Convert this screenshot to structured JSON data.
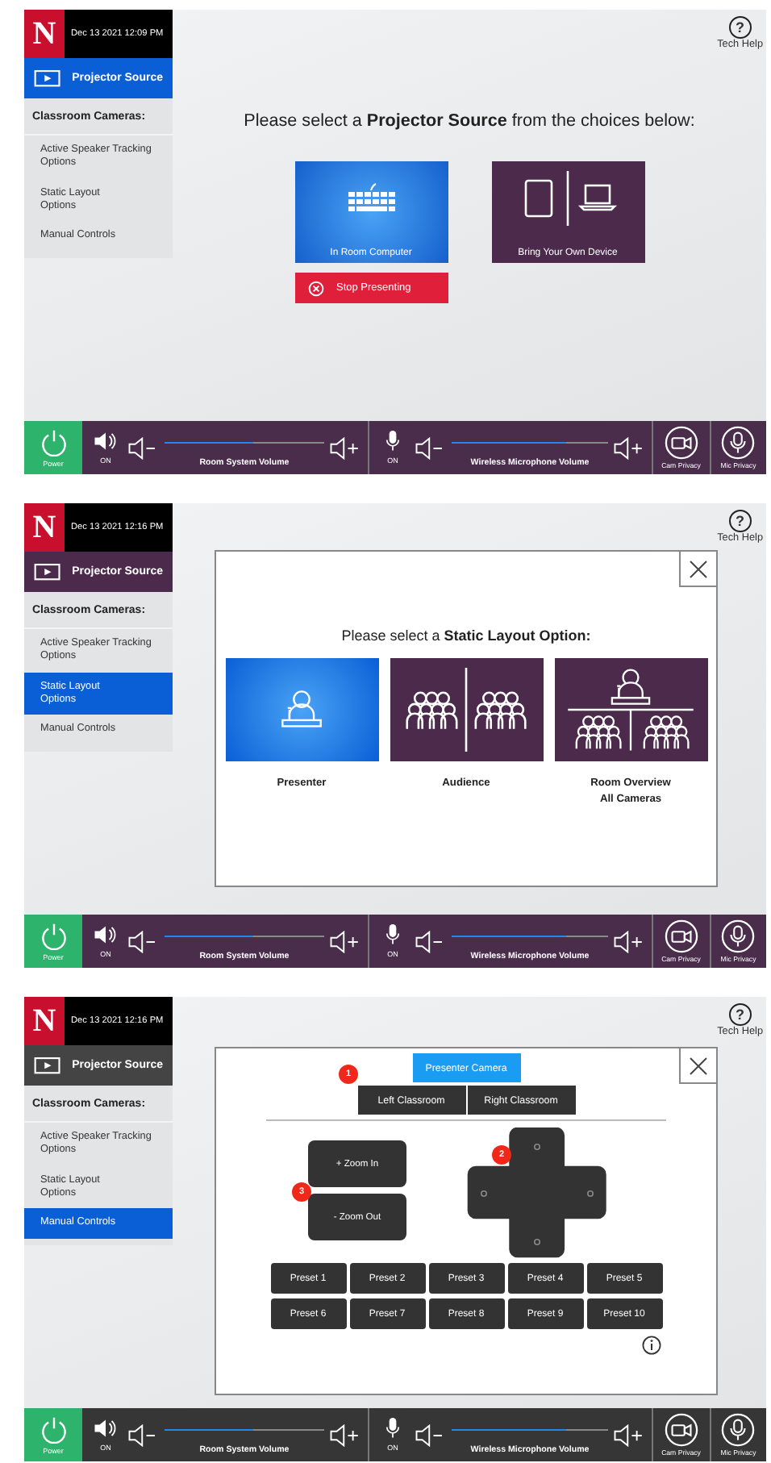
{
  "screens": [
    {
      "header": {
        "logo": "N",
        "date": "Dec 13 2021 12:09 PM"
      },
      "projector_source": {
        "label": "Projector Source",
        "selected": true
      },
      "sidebar": {
        "heading": "Classroom Cameras:",
        "items": [
          {
            "label": "Active Speaker Tracking\nOptions",
            "selected": false
          },
          {
            "label": "Static Layout\nOptions",
            "selected": false
          },
          {
            "label": "Manual Controls",
            "selected": false
          }
        ]
      },
      "tech_help": {
        "icon": "?",
        "label": "Tech Help"
      },
      "content": {
        "kind": "source_select",
        "title": "Please select a **Projector Source** from the choices below:",
        "options": [
          {
            "kind": "computer",
            "label": "In Room Computer",
            "selected": true
          },
          {
            "kind": "byod",
            "label": "Bring Your Own Device",
            "selected": false
          }
        ],
        "stop_button": "Stop Presenting"
      },
      "bottom_bar": {
        "power": "Power",
        "volumes": [
          {
            "kind": "speaker",
            "mute_label": "ON",
            "label": "Room System Volume",
            "level": 0.56
          },
          {
            "kind": "mic",
            "mute_label": "ON",
            "label": "Wireless Microphone Volume",
            "level": 0.73
          }
        ],
        "privacy": [
          {
            "kind": "camera",
            "label": "Cam Privacy"
          },
          {
            "kind": "mic",
            "label": "Mic Privacy"
          }
        ]
      }
    },
    {
      "header": {
        "logo": "N",
        "date": "Dec 13 2021 12:16 PM"
      },
      "projector_source": {
        "label": "Projector Source",
        "selected": false
      },
      "sidebar": {
        "heading": "Classroom Cameras:",
        "items": [
          {
            "label": "Active Speaker Tracking\nOptions",
            "selected": false
          },
          {
            "label": "Static Layout\nOptions",
            "selected": true
          },
          {
            "label": "Manual Controls",
            "selected": false
          }
        ]
      },
      "tech_help": {
        "icon": "?",
        "label": "Tech Help"
      },
      "content": {
        "kind": "layout_select",
        "title": "Please select a **Static Layout Option:**",
        "options": [
          {
            "kind": "presenter",
            "label": "Presenter",
            "selected": true
          },
          {
            "kind": "audience",
            "label": "Audience",
            "selected": false
          },
          {
            "kind": "overview",
            "label": "Room Overview\nAll Cameras",
            "selected": false
          }
        ]
      },
      "bottom_bar": {
        "power": "Power",
        "volumes": [
          {
            "kind": "speaker",
            "mute_label": "ON",
            "label": "Room System Volume",
            "level": 0.56
          },
          {
            "kind": "mic",
            "mute_label": "ON",
            "label": "Wireless Microphone Volume",
            "level": 0.73
          }
        ],
        "privacy": [
          {
            "kind": "camera",
            "label": "Cam Privacy"
          },
          {
            "kind": "mic",
            "label": "Mic Privacy"
          }
        ]
      }
    },
    {
      "header": {
        "logo": "N",
        "date": "Dec 13 2021 12:16 PM"
      },
      "projector_source": {
        "label": "Projector Source",
        "selected": false
      },
      "sidebar": {
        "heading": "Classroom Cameras:",
        "items": [
          {
            "label": "Active Speaker Tracking\nOptions",
            "selected": false
          },
          {
            "label": "Static Layout\nOptions",
            "selected": false
          },
          {
            "label": "Manual Controls",
            "selected": true
          }
        ]
      },
      "tech_help": {
        "icon": "?",
        "label": "Tech Help"
      },
      "content": {
        "kind": "manual_controls",
        "cameras": [
          {
            "label": "Presenter Camera",
            "selected": true
          },
          {
            "label": "Left Classroom",
            "selected": false
          },
          {
            "label": "Right Classroom",
            "selected": false
          }
        ],
        "zoom": [
          "+ Zoom In",
          "- Zoom Out"
        ],
        "callouts": [
          "1",
          "2",
          "3"
        ],
        "presets": [
          "Preset 1",
          "Preset 2",
          "Preset 3",
          "Preset 4",
          "Preset 5",
          "Preset 6",
          "Preset 7",
          "Preset 8",
          "Preset 9",
          "Preset 10"
        ]
      },
      "bottom_bar": {
        "power": "Power",
        "volumes": [
          {
            "kind": "speaker",
            "mute_label": "ON",
            "label": "Room System Volume",
            "level": 0.56
          },
          {
            "kind": "mic",
            "mute_label": "ON",
            "label": "Wireless Microphone Volume",
            "level": 0.73
          }
        ],
        "privacy": [
          {
            "kind": "camera",
            "label": "Cam Privacy"
          },
          {
            "kind": "mic",
            "label": "Mic Privacy"
          }
        ]
      }
    }
  ]
}
